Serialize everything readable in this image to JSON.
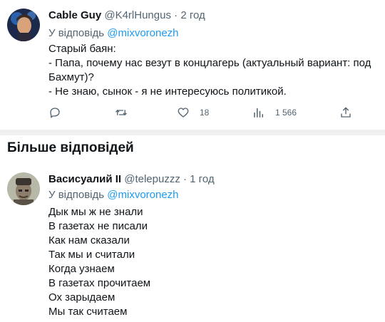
{
  "tweet1": {
    "name": "Cable Guy",
    "handle": "@K4rlHungus",
    "dot": "·",
    "time": "2 год",
    "reply_prefix": "У відповідь",
    "reply_to": "@mixvoronezh",
    "lines": [
      "Старый баян:",
      "- Папа, почему нас везут в концлагерь (актуальный вариант: под",
      "Бахмут)?",
      "- Не знаю, сынок - я не интересуюсь политикой."
    ],
    "actions": {
      "likes": "18",
      "views": "1 566"
    }
  },
  "section": {
    "title": "Більше відповідей"
  },
  "tweet2": {
    "name": "Васисуалий II",
    "handle": "@telepuzzz",
    "dot": "·",
    "time": "1 год",
    "reply_prefix": "У відповідь",
    "reply_to": "@mixvoronezh",
    "lines": [
      "Дык мы ж не знали",
      "В газетах не писали",
      "Как нам сказали",
      "Так мы и считали",
      "Когда узнаем",
      "В газетах прочитаем",
      "Ох зарыдаем",
      "Мы так считаем"
    ]
  },
  "colors": {
    "accent": "#1d9bf0",
    "muted": "#536471",
    "text": "#0f1419"
  },
  "icons": [
    "reply-icon",
    "retweet-icon",
    "like-icon",
    "views-icon",
    "share-icon"
  ]
}
